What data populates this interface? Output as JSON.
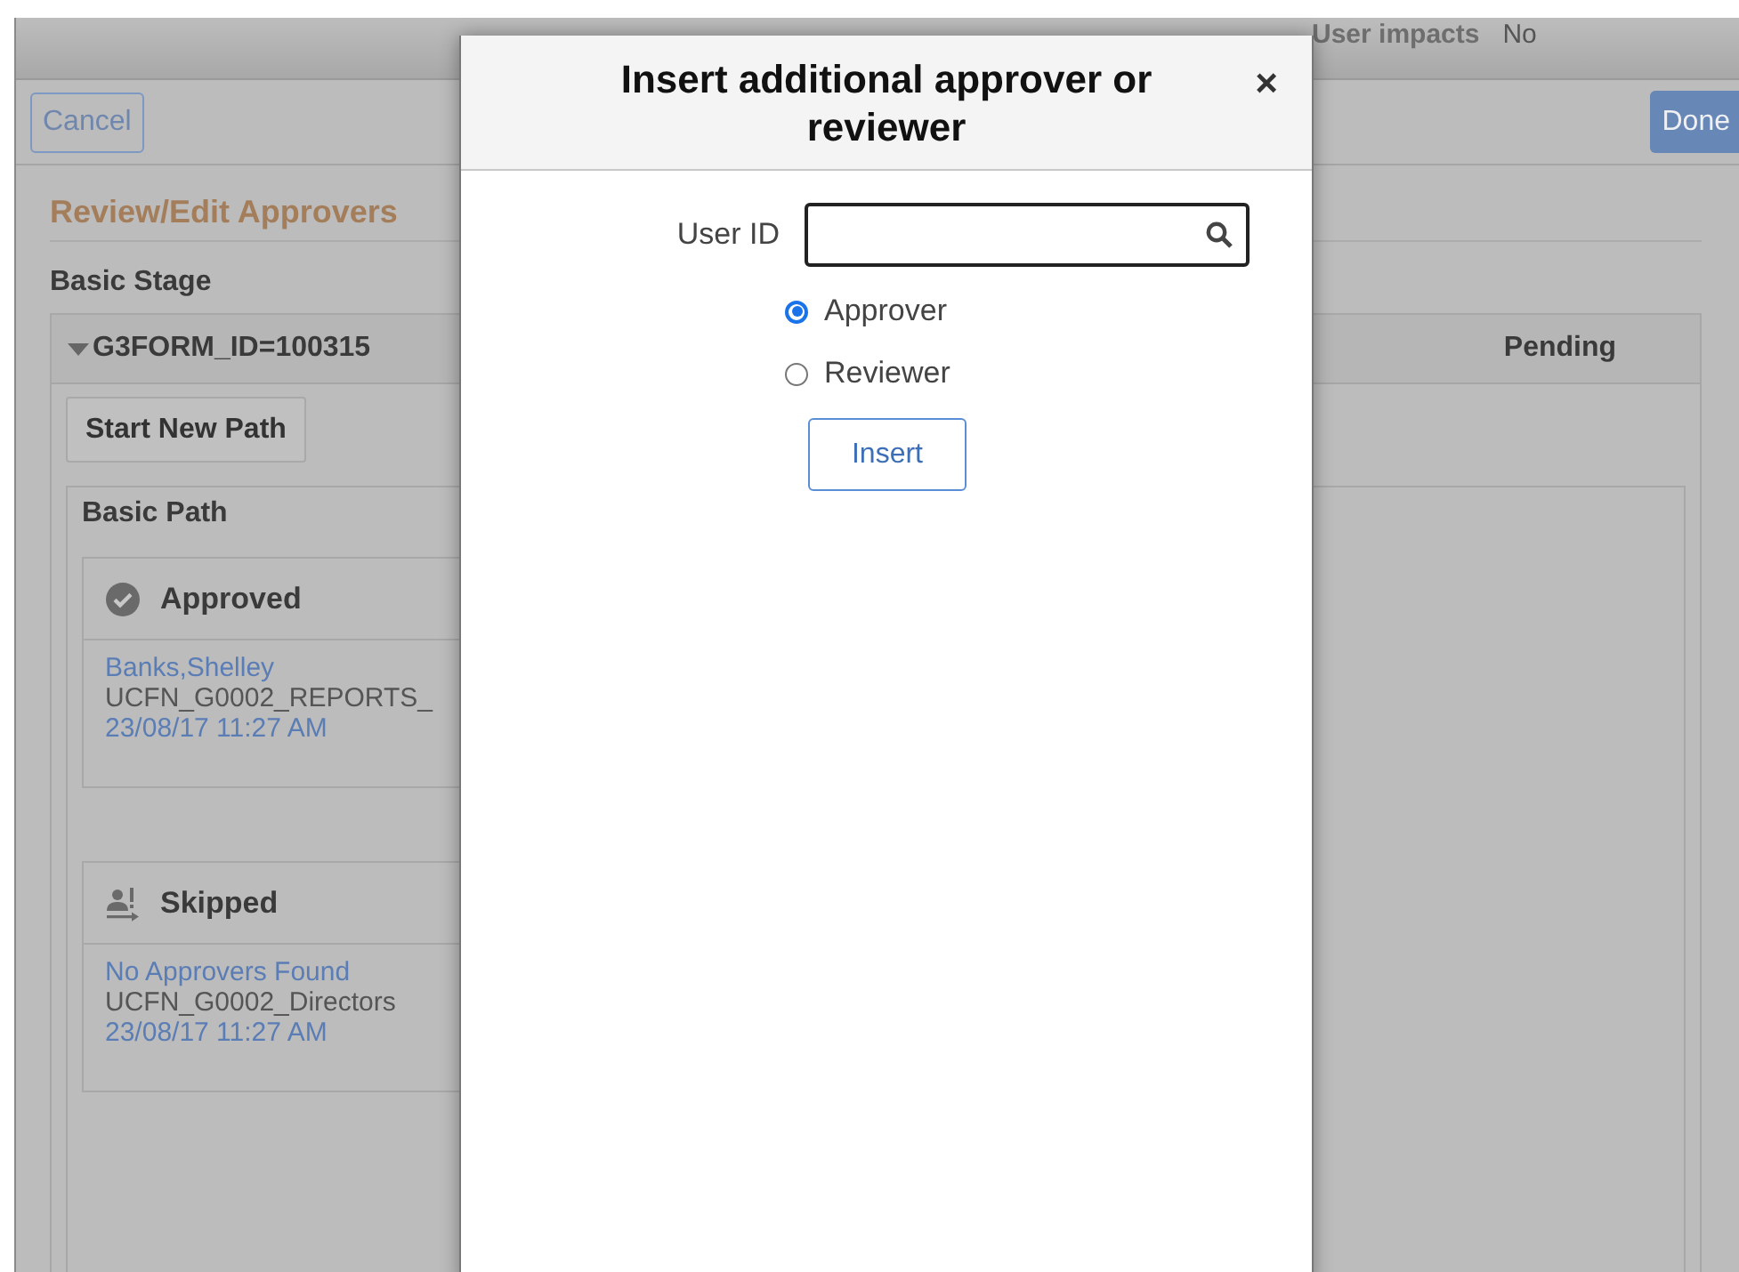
{
  "background_page": {
    "top_fields": [
      {
        "label": "User impacts",
        "value": "No"
      }
    ],
    "cancel_button": "Cancel",
    "done_button": "Done",
    "title": "Review/Edit Approvers",
    "stage_title": "Basic Stage",
    "stage": {
      "name": "G3FORM_ID=100315",
      "expanded": true,
      "status": "Pending"
    },
    "start_new_path_button": "Start New Path",
    "path_title": "Basic Path",
    "steps": [
      {
        "kind": "approved",
        "status": "Approved",
        "approver": "Banks,Shelley",
        "role": "UCFN_G0002_REPORTS_",
        "datetime": "23/08/17 11:27 AM"
      },
      {
        "kind": "skipped",
        "status": "Skipped",
        "approver": "No Approvers Found",
        "role": "UCFN_G0002_Directors",
        "datetime": "23/08/17 11:27 AM"
      }
    ]
  },
  "dialog": {
    "title": "Insert additional approver or reviewer",
    "close": "×",
    "user_id_label": "User ID",
    "options": [
      {
        "label": "Approver",
        "selected": true
      },
      {
        "label": "Reviewer",
        "selected": false
      }
    ],
    "insert_button": "Insert"
  }
}
